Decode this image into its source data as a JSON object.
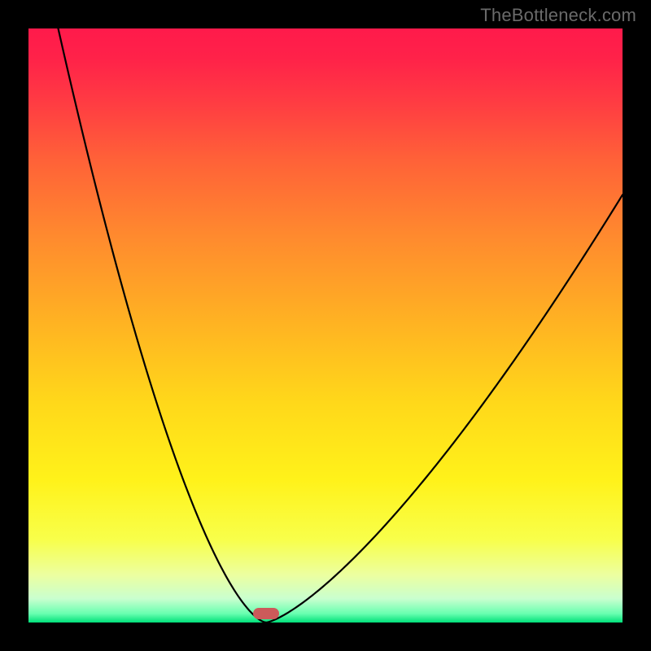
{
  "watermark": "TheBottleneck.com",
  "chart_data": {
    "type": "line",
    "title": "",
    "xlabel": "",
    "ylabel": "",
    "xlim": [
      0,
      100
    ],
    "ylim": [
      0,
      100
    ],
    "grid": false,
    "legend": false,
    "curve": {
      "min_x": 40,
      "min_y": 0,
      "left_start": {
        "x": 5,
        "y": 100
      },
      "right_end": {
        "x": 100,
        "y": 72
      },
      "description": "V-shaped bottleneck curve: steep descent from top-left to a minimum near x=40 at y=0, then rises to the right edge at roughly y=72."
    },
    "marker": {
      "x": 40,
      "y": 1.5
    },
    "background_gradient": {
      "stops": [
        {
          "pos": 0.0,
          "color": "#ff1a4b"
        },
        {
          "pos": 0.05,
          "color": "#ff2249"
        },
        {
          "pos": 0.12,
          "color": "#ff3a43"
        },
        {
          "pos": 0.22,
          "color": "#ff6138"
        },
        {
          "pos": 0.35,
          "color": "#ff8a2e"
        },
        {
          "pos": 0.5,
          "color": "#ffb422"
        },
        {
          "pos": 0.63,
          "color": "#ffd81a"
        },
        {
          "pos": 0.76,
          "color": "#fff21a"
        },
        {
          "pos": 0.86,
          "color": "#f8ff4a"
        },
        {
          "pos": 0.92,
          "color": "#ecffa0"
        },
        {
          "pos": 0.96,
          "color": "#c9ffcf"
        },
        {
          "pos": 0.985,
          "color": "#69ffb0"
        },
        {
          "pos": 1.0,
          "color": "#00e07a"
        }
      ]
    }
  }
}
